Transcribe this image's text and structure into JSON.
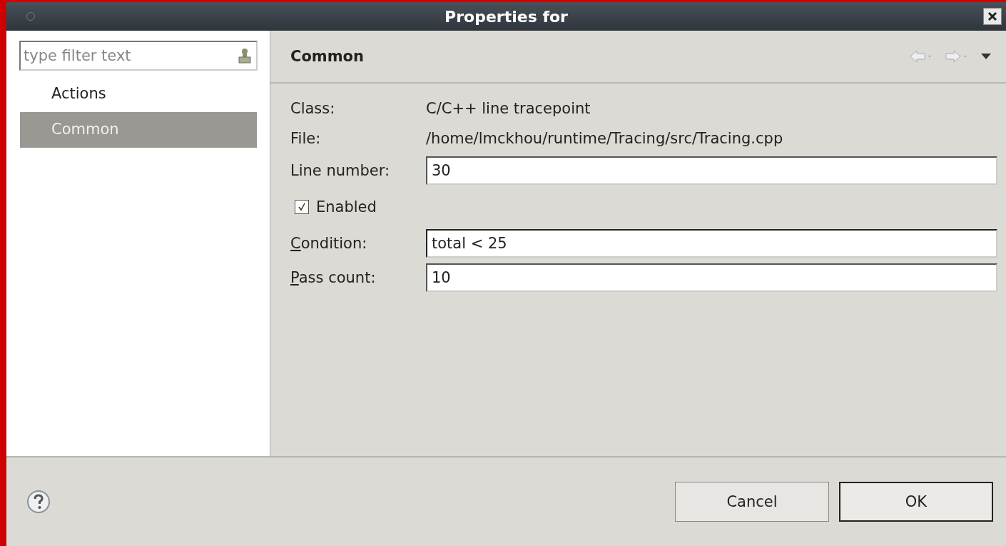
{
  "window": {
    "title": "Properties for"
  },
  "filter": {
    "placeholder": "type filter text"
  },
  "pages": [
    {
      "label": "Actions",
      "selected": false
    },
    {
      "label": "Common",
      "selected": true
    }
  ],
  "page_title": "Common",
  "rows": [
    {
      "kind": "info",
      "label": "Class:",
      "value": "C/C++ line tracepoint"
    },
    {
      "kind": "info",
      "label": "File:",
      "value": "/home/lmckhou/runtime/Tracing/src/Tracing.cpp"
    },
    {
      "kind": "field",
      "label": "Line number:",
      "value": "30",
      "mnemonic": false,
      "focused": false
    },
    {
      "kind": "checkbox",
      "label": "Enabled",
      "checked": true
    },
    {
      "kind": "field",
      "label": "Condition:",
      "value": "total < 25",
      "mnemonic": true,
      "focused": true
    },
    {
      "kind": "field",
      "label": "Pass count:",
      "value": "10",
      "mnemonic": true,
      "focused": false
    }
  ],
  "buttons": [
    {
      "label": "Cancel",
      "default": false
    },
    {
      "label": "OK",
      "default": true
    }
  ]
}
